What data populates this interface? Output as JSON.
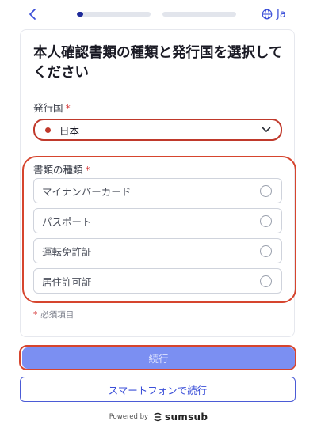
{
  "header": {
    "language_code": "Ja",
    "progress": [
      {
        "step": 1,
        "fill": 0.08
      },
      {
        "step": 2,
        "fill": 0
      }
    ]
  },
  "form": {
    "title": "本人確認書類の種類と発行国を選択してください",
    "country": {
      "label": "発行国",
      "required_mark": "*",
      "selected_value": "日本"
    },
    "doc_type": {
      "label": "書類の種類",
      "required_mark": "*",
      "options": [
        {
          "label": "マイナンバーカード"
        },
        {
          "label": "パスポート"
        },
        {
          "label": "運転免許証"
        },
        {
          "label": "居住許可証"
        }
      ]
    },
    "required_note": "必須項目",
    "required_note_mark": "*"
  },
  "actions": {
    "continue_label": "続行",
    "phone_label": "スマートフォンで続行"
  },
  "footer": {
    "powered_by": "Powered by",
    "brand": "sumsub"
  },
  "colors": {
    "accent": "#3b4fd8",
    "button_fill": "#7b8ff2",
    "highlight": "#d6452e"
  }
}
